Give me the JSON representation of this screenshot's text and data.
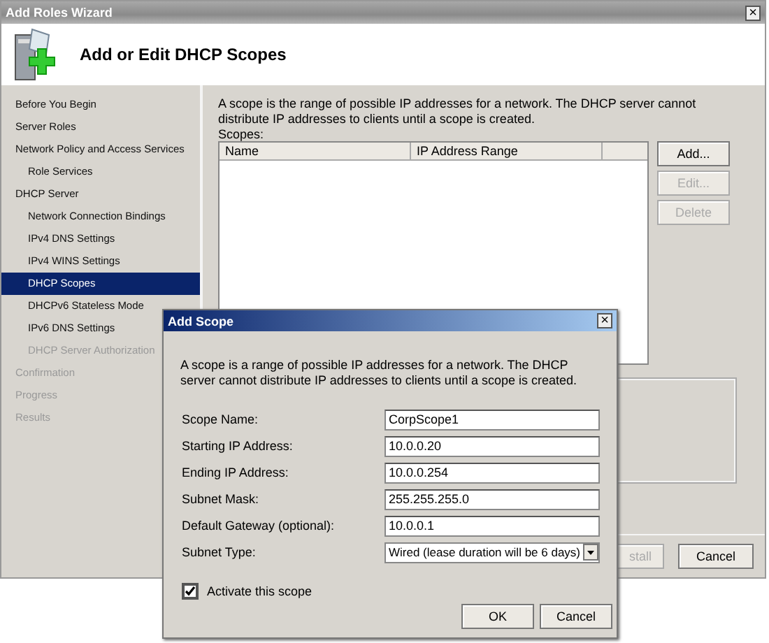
{
  "window": {
    "title": "Add Roles Wizard",
    "close": "×"
  },
  "header": {
    "title": "Add or Edit DHCP Scopes"
  },
  "sidebar": {
    "items": [
      {
        "label": "Before You Begin",
        "selected": false,
        "disabled": false
      },
      {
        "label": "Server Roles",
        "selected": false,
        "disabled": false
      },
      {
        "label": "Network Policy and Access Services",
        "selected": false,
        "disabled": false,
        "children": [
          {
            "label": "Role Services",
            "selected": false,
            "disabled": false
          }
        ]
      },
      {
        "label": "DHCP Server",
        "selected": false,
        "disabled": false,
        "children": [
          {
            "label": "Network Connection Bindings",
            "selected": false,
            "disabled": false
          },
          {
            "label": "IPv4 DNS Settings",
            "selected": false,
            "disabled": false
          },
          {
            "label": "IPv4 WINS Settings",
            "selected": false,
            "disabled": false
          },
          {
            "label": "DHCP Scopes",
            "selected": true,
            "disabled": false
          },
          {
            "label": "DHCPv6 Stateless Mode",
            "selected": false,
            "disabled": false
          },
          {
            "label": "IPv6 DNS Settings",
            "selected": false,
            "disabled": false
          },
          {
            "label": "DHCP Server Authorization",
            "selected": false,
            "disabled": true
          }
        ]
      },
      {
        "label": "Confirmation",
        "selected": false,
        "disabled": true
      },
      {
        "label": "Progress",
        "selected": false,
        "disabled": true
      },
      {
        "label": "Results",
        "selected": false,
        "disabled": true
      }
    ]
  },
  "content": {
    "description": "A scope is the range of possible IP addresses for a network. The DHCP server cannot distribute IP addresses to clients until a scope is created.",
    "scopes_label": "Scopes:",
    "table": {
      "columns": [
        "Name",
        "IP Address Range"
      ]
    },
    "buttons": [
      {
        "label": "Add...",
        "disabled": false
      },
      {
        "label": "Edit...",
        "disabled": true
      },
      {
        "label": "Delete",
        "disabled": true
      }
    ],
    "footer_buttons": [
      {
        "label": "stall",
        "disabled": true
      },
      {
        "label": "Cancel",
        "disabled": false
      }
    ]
  },
  "dialog": {
    "title": "Add Scope",
    "close": "×",
    "description": "A scope is a range of possible IP addresses for a network. The DHCP server cannot distribute IP addresses to clients until a scope is created.",
    "fields": [
      {
        "kind": "text",
        "label": "Scope Name:",
        "value": "CorpScope1"
      },
      {
        "kind": "text",
        "label": "Starting IP Address:",
        "value": "10.0.0.20"
      },
      {
        "kind": "text",
        "label": "Ending IP Address:",
        "value": "10.0.0.254"
      },
      {
        "kind": "text",
        "label": "Subnet Mask:",
        "value": "255.255.255.0"
      },
      {
        "kind": "text",
        "label": "Default Gateway (optional):",
        "value": "10.0.0.1"
      },
      {
        "kind": "dropdown",
        "label": "Subnet Type:",
        "value": "Wired (lease duration will be 6 days)"
      }
    ],
    "activate": {
      "label": "Activate this scope",
      "checked": true
    },
    "buttons": [
      "OK",
      "Cancel"
    ]
  }
}
